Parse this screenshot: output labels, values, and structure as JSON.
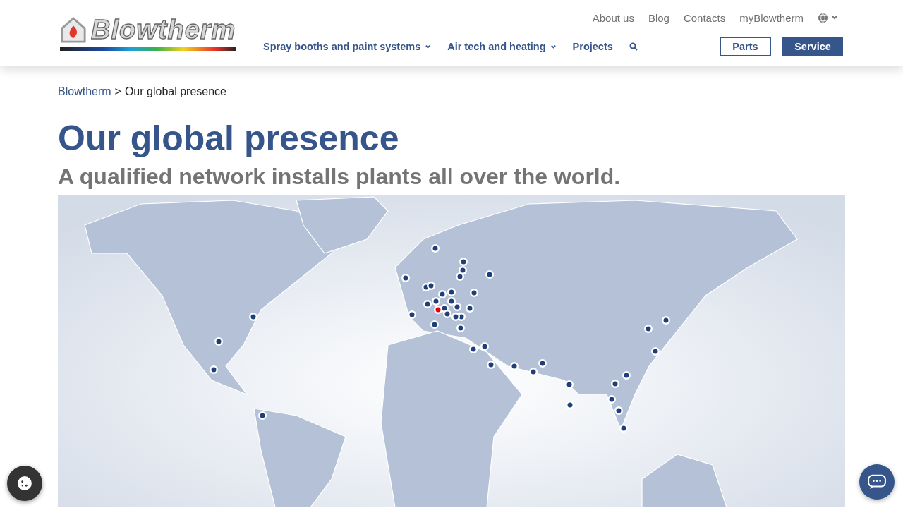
{
  "header": {
    "logo": "Blowtherm",
    "top_links": [
      "About us",
      "Blog",
      "Contacts",
      "myBlowtherm"
    ],
    "main_nav": [
      {
        "label": "Spray booths and paint systems",
        "dropdown": true
      },
      {
        "label": "Air tech and heating",
        "dropdown": true
      },
      {
        "label": "Projects",
        "dropdown": false
      }
    ],
    "buttons": [
      {
        "label": "Parts",
        "kind": "outline"
      },
      {
        "label": "Service",
        "kind": "filled"
      }
    ]
  },
  "breadcrumb": {
    "link": "Blowtherm",
    "separator": ">",
    "current": "Our global presence"
  },
  "title": "Our global presence",
  "subtitle": "A qualified network installs plants all over the world."
}
